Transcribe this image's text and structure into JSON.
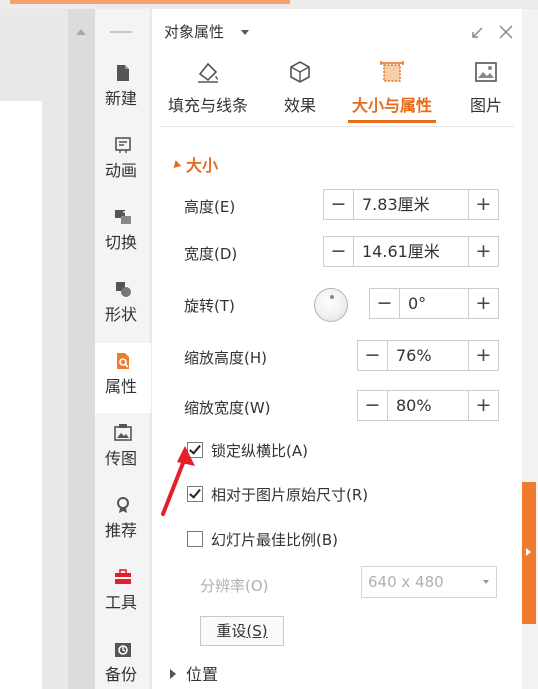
{
  "sidebar": {
    "items": [
      {
        "label": "新建",
        "icon": "new-doc-icon"
      },
      {
        "label": "动画",
        "icon": "animation-icon"
      },
      {
        "label": "切换",
        "icon": "transition-icon"
      },
      {
        "label": "形状",
        "icon": "shape-icon"
      },
      {
        "label": "属性",
        "icon": "properties-icon",
        "active": true
      },
      {
        "label": "传图",
        "icon": "upload-image-icon"
      },
      {
        "label": "推荐",
        "icon": "recommend-icon"
      },
      {
        "label": "工具",
        "icon": "toolbox-icon"
      },
      {
        "label": "备份",
        "icon": "backup-icon"
      }
    ]
  },
  "panel": {
    "title": "对象属性",
    "tabs": [
      {
        "label": "填充与线条",
        "icon": "fill-line-icon"
      },
      {
        "label": "效果",
        "icon": "effects-icon"
      },
      {
        "label": "大小与属性",
        "icon": "size-properties-icon",
        "active": true
      },
      {
        "label": "图片",
        "icon": "picture-icon"
      }
    ],
    "size_section": {
      "heading": "大小",
      "height": {
        "label": "高度(E)",
        "value": "7.83厘米"
      },
      "width": {
        "label": "宽度(D)",
        "value": "14.61厘米"
      },
      "rotation": {
        "label": "旋转(T)",
        "value": "0°"
      },
      "scale_height": {
        "label": "缩放高度(H)",
        "value": "76%"
      },
      "scale_width": {
        "label": "缩放宽度(W)",
        "value": "80%"
      },
      "lock_ratio": {
        "label": "锁定纵横比(A)",
        "checked": true
      },
      "relative_original": {
        "label": "相对于图片原始尺寸(R)",
        "checked": true
      },
      "slide_best_ratio": {
        "label": "幻灯片最佳比例(B)",
        "checked": false
      },
      "resolution": {
        "label": "分辨率(O)",
        "value": "640 x 480"
      },
      "reset": {
        "label": "重设",
        "hotkey": "(S)"
      }
    },
    "position_section": {
      "heading": "位置"
    },
    "spin_minus": "−",
    "spin_plus": "+"
  },
  "colors": {
    "accent": "#e66b1c",
    "annotation_arrow": "#e3202a",
    "edge_tab": "#ef7b2f"
  }
}
